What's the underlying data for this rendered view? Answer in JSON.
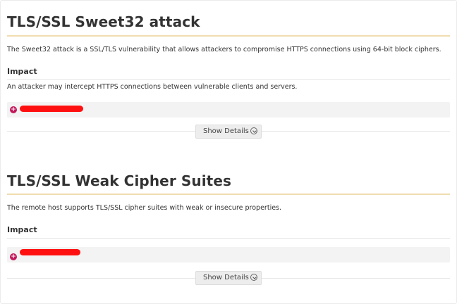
{
  "vulnerabilities": [
    {
      "title": "TLS/SSL Sweet32 attack",
      "description": "The Sweet32 attack is a SSL/TLS vulnerability that allows attackers to compromise HTTPS connections using 64-bit block ciphers.",
      "impact_heading": "Impact",
      "impact_text": "An attacker may intercept HTTPS connections between vulnerable clients and servers.",
      "details_button": "Show Details"
    },
    {
      "title": "TLS/SSL Weak Cipher Suites",
      "description": "The remote host supports TLS/SSL cipher suites with weak or insecure properties.",
      "impact_heading": "Impact",
      "impact_text": "",
      "details_button": "Show Details"
    }
  ],
  "colors": {
    "title_underline": "#f1ddb0",
    "expand_icon": "#c2185b",
    "redaction": "#ff1010"
  }
}
